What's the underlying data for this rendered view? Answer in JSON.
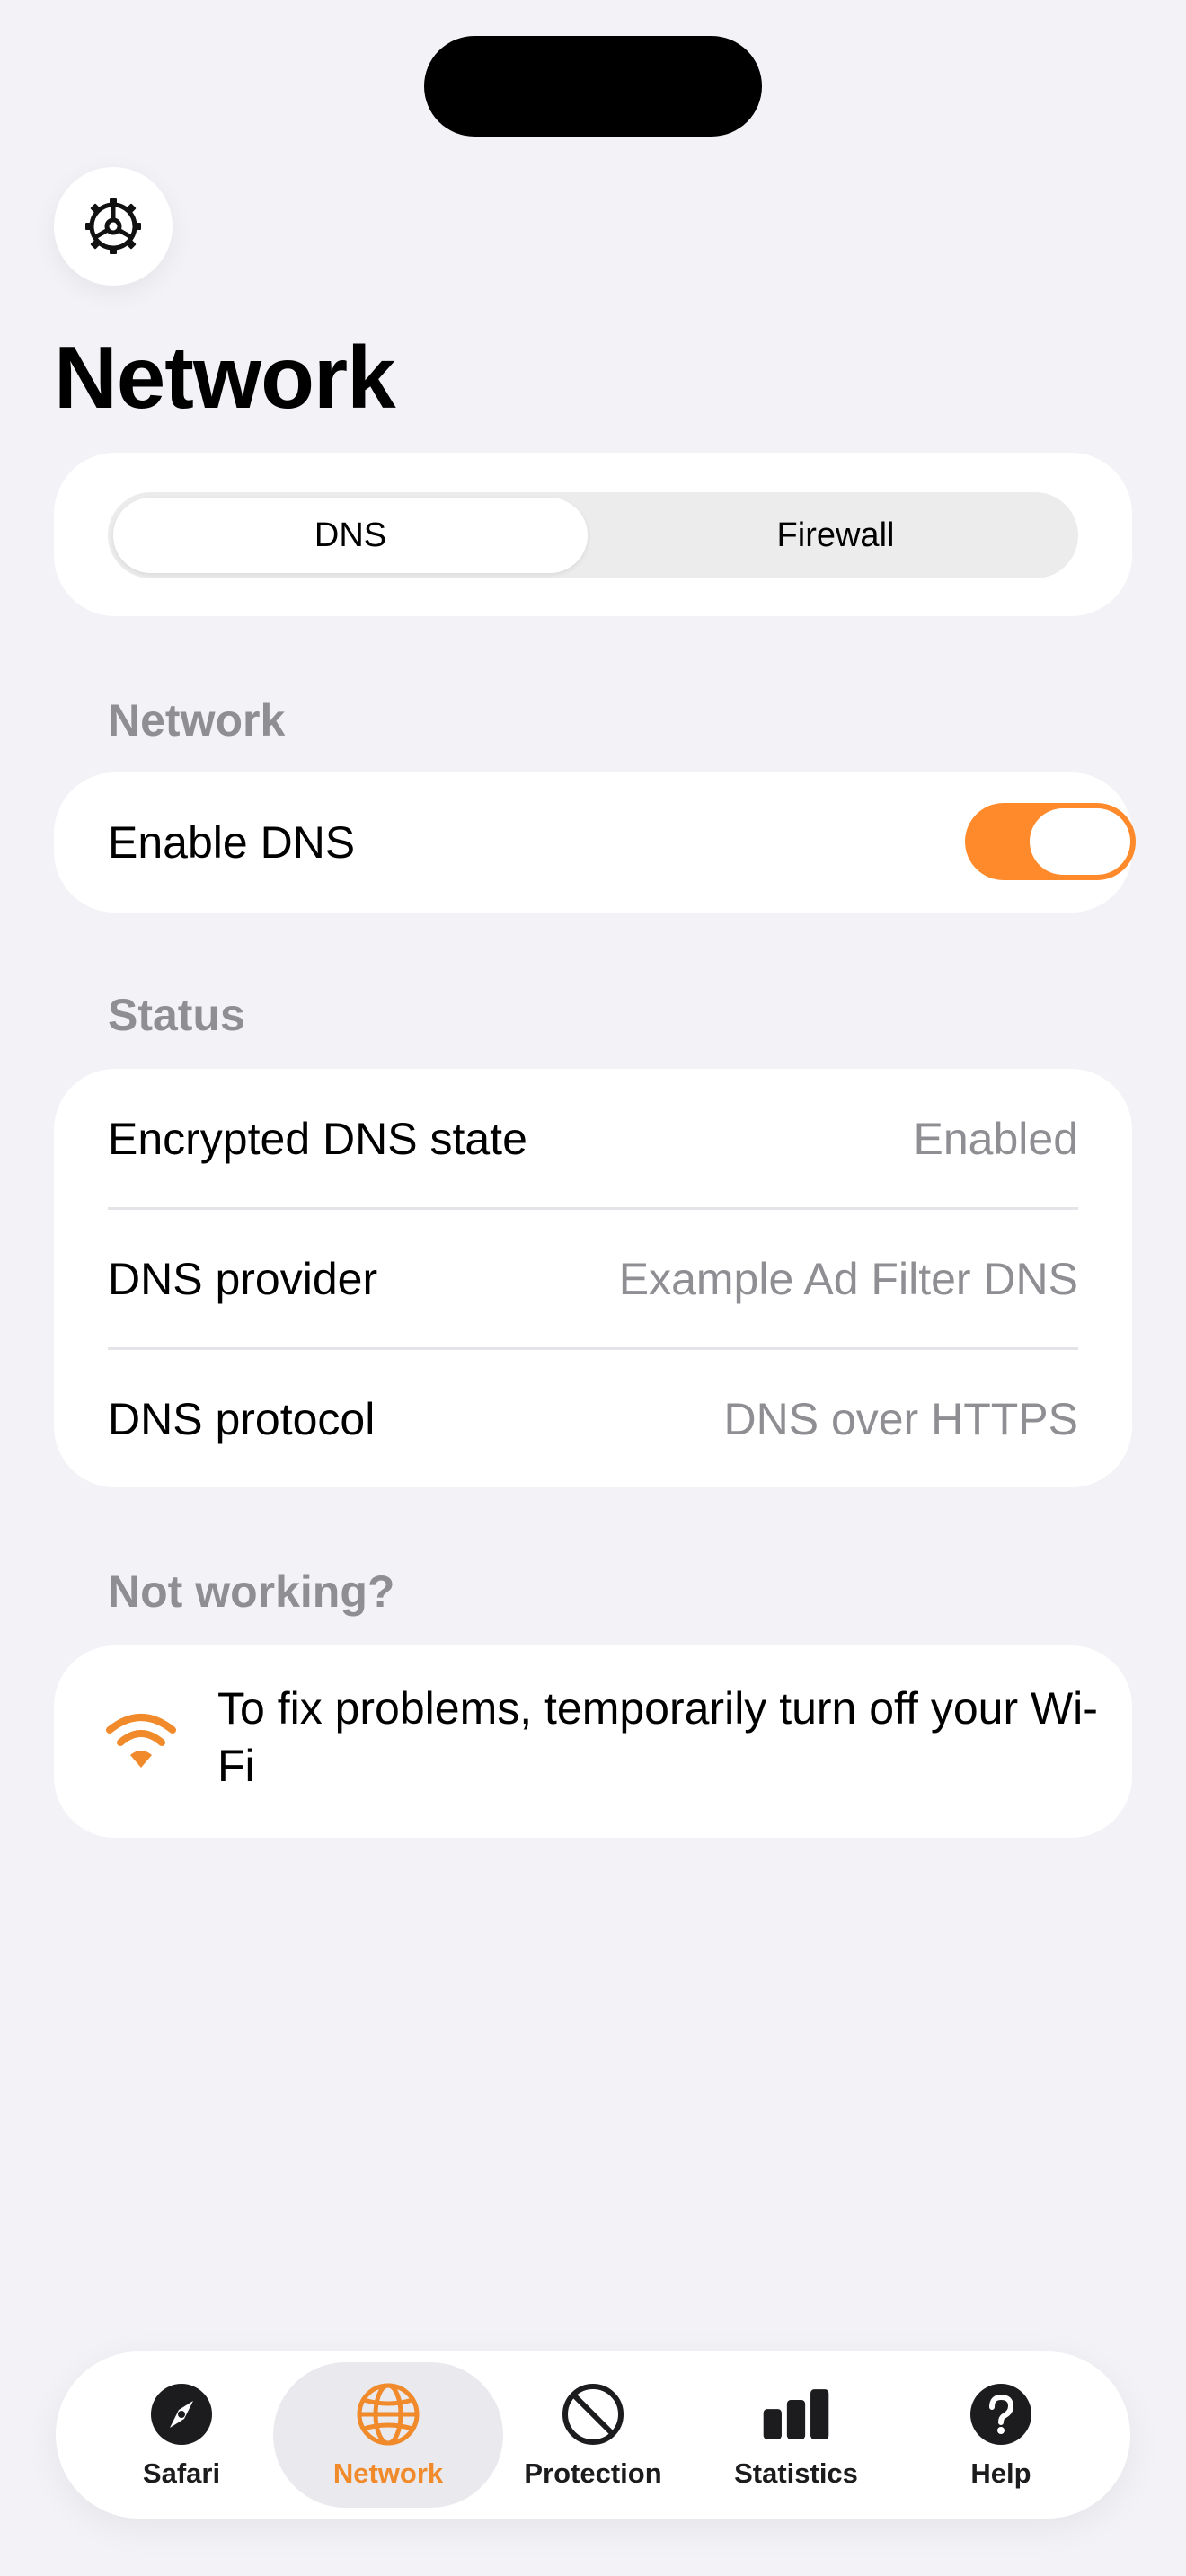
{
  "colors": {
    "accent": "#ff8a2b",
    "background": "#f2f2f7",
    "secondary_text": "#8e8e93"
  },
  "header": {
    "settings_icon": "gear-icon",
    "title": "Network"
  },
  "segmented": {
    "options": [
      "DNS",
      "Firewall"
    ],
    "selected": "DNS"
  },
  "network_section": {
    "header": "Network",
    "enable_dns_label": "Enable DNS",
    "enable_dns_on": true
  },
  "status_section": {
    "header": "Status",
    "rows": [
      {
        "label": "Encrypted DNS state",
        "value": "Enabled"
      },
      {
        "label": "DNS provider",
        "value": "Example Ad Filter DNS"
      },
      {
        "label": "DNS protocol",
        "value": "DNS over HTTPS"
      }
    ]
  },
  "help_section": {
    "header": "Not working?",
    "icon": "wifi-icon",
    "text": "To fix problems, temporarily turn off your Wi-Fi"
  },
  "tabbar": {
    "selected": "Network",
    "tabs": [
      {
        "label": "Safari",
        "icon": "compass-icon"
      },
      {
        "label": "Network",
        "icon": "globe-icon"
      },
      {
        "label": "Protection",
        "icon": "block-icon"
      },
      {
        "label": "Statistics",
        "icon": "bar-chart-icon"
      },
      {
        "label": "Help",
        "icon": "question-icon"
      }
    ]
  }
}
